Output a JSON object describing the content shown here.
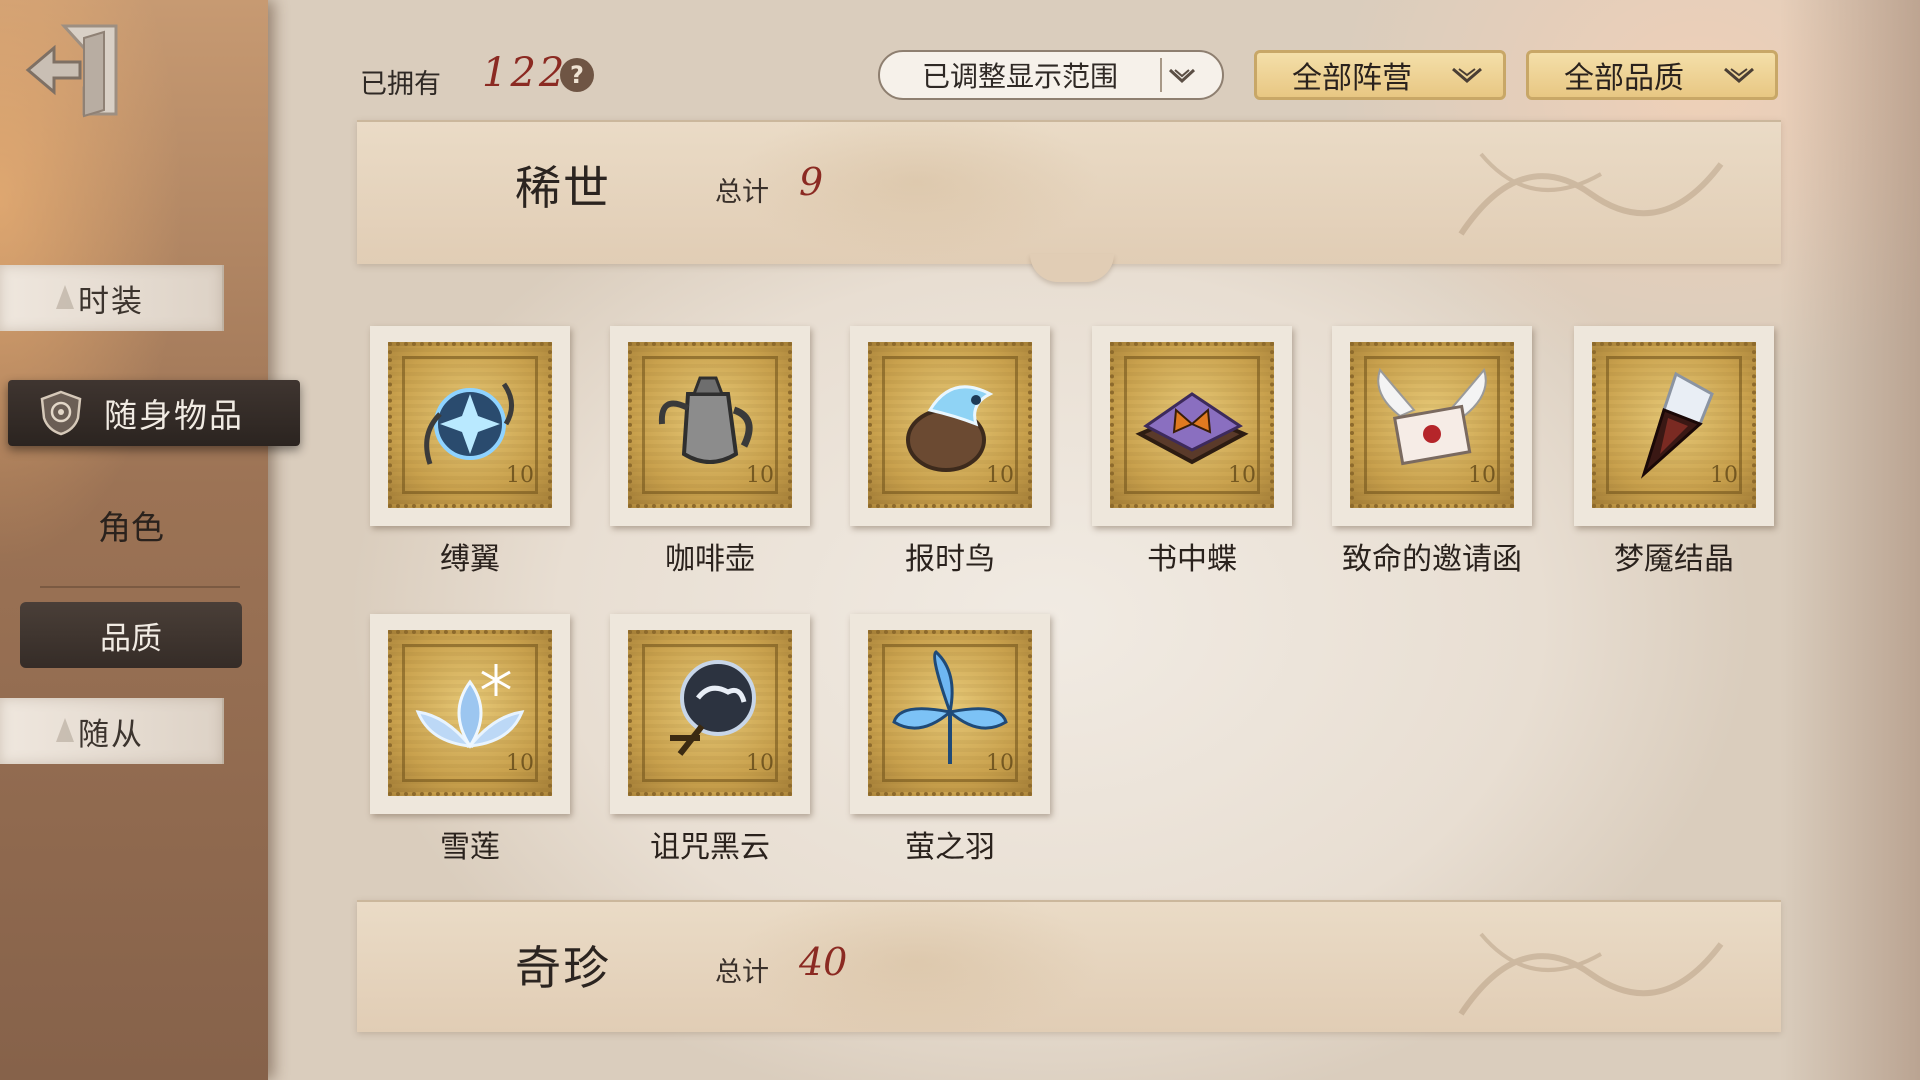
{
  "sidebar": {
    "tabs": [
      {
        "label": "时装"
      },
      {
        "label": "随身物品"
      },
      {
        "label": "随从"
      }
    ],
    "sub": {
      "character": "角色",
      "quality": "品质"
    }
  },
  "topbar": {
    "owned_label": "已拥有",
    "owned_count": "122",
    "help": "?",
    "range_filter": "已调整显示范围",
    "faction_filter": "全部阵营",
    "quality_filter": "全部品质"
  },
  "sections": [
    {
      "title": "稀世",
      "total_label": "总计",
      "total": "9"
    },
    {
      "title": "奇珍",
      "total_label": "总计",
      "total": "40"
    }
  ],
  "items": [
    {
      "name": "缚翼",
      "icon": "winged-orb-icon"
    },
    {
      "name": "咖啡壶",
      "icon": "coffee-pot-icon"
    },
    {
      "name": "报时鸟",
      "icon": "clock-bird-icon"
    },
    {
      "name": "书中蝶",
      "icon": "book-butterfly-icon"
    },
    {
      "name": "致命的邀请函",
      "icon": "winged-letter-icon"
    },
    {
      "name": "梦魇结晶",
      "icon": "nightmare-crystal-icon"
    },
    {
      "name": "雪莲",
      "icon": "snow-lotus-icon"
    },
    {
      "name": "诅咒黑云",
      "icon": "cursed-cloud-orb-icon"
    },
    {
      "name": "萤之羽",
      "icon": "firefly-wing-icon"
    }
  ],
  "stamp_denomination": "10",
  "colors": {
    "accent_red": "#8b2a22",
    "stamp_gold": "#c9a14d",
    "filter_gold": "#e8c783",
    "dark_tab": "#352c27"
  }
}
